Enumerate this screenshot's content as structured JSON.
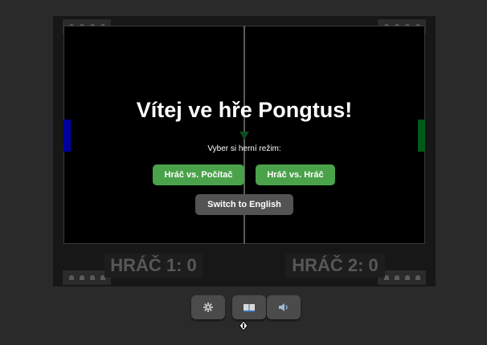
{
  "game": {
    "title": "Vítej ve hře Pongtus!",
    "subtitle": "Vyber si herní režim:",
    "mode_buttons": [
      {
        "label": "Hráč vs. Počítač"
      },
      {
        "label": "Hráč vs. Hráč"
      }
    ],
    "language_button": "Switch to English",
    "scores": {
      "player1": "HRÁČ 1: 0",
      "player2": "HRÁČ 2: 0"
    }
  },
  "toolbar": {
    "buttons": [
      {
        "icon": "gear-icon"
      },
      {
        "icon": "book-icon"
      },
      {
        "icon": "speaker-icon"
      }
    ]
  },
  "colors": {
    "left_paddle": "#0000a0",
    "right_paddle": "#005a1a",
    "button_green": "#4aa24a",
    "button_gray": "#535353"
  }
}
